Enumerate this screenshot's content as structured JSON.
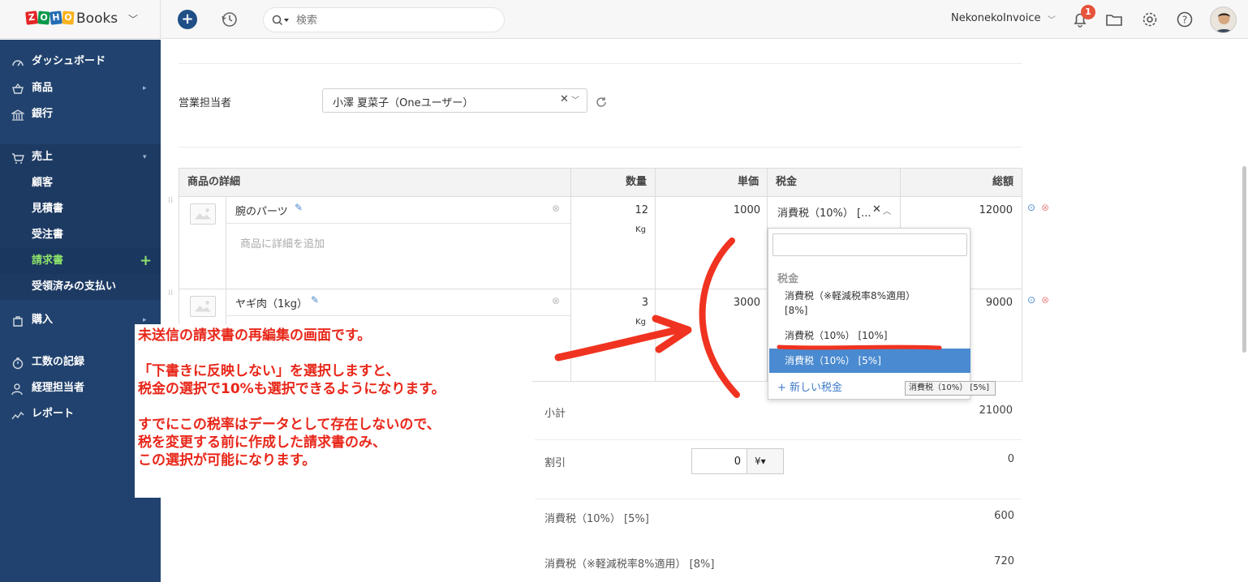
{
  "brand": {
    "logo_letters": [
      "Z",
      "O",
      "H",
      "O"
    ],
    "logo_colors": [
      "#e42527",
      "#089949",
      "#226db4",
      "#f9b21d"
    ],
    "name": "Books"
  },
  "topbar": {
    "search_placeholder": "検索",
    "org_name": "NekonekoInvoice",
    "notification_count": "1"
  },
  "sidebar": {
    "items": [
      {
        "label": "ダッシュボード",
        "icon": "dashboard-icon"
      },
      {
        "label": "商品",
        "icon": "cart-icon"
      },
      {
        "label": "銀行",
        "icon": "bank-icon"
      },
      {
        "label": "売上",
        "icon": "cart-icon"
      },
      {
        "label": "顧客"
      },
      {
        "label": "見積書"
      },
      {
        "label": "受注書"
      },
      {
        "label": "請求書"
      },
      {
        "label": "受領済みの支払い"
      },
      {
        "label": "購入",
        "icon": "bag-icon"
      },
      {
        "label": "工数の記録",
        "icon": "timer-icon"
      },
      {
        "label": "経理担当者",
        "icon": "user-icon"
      },
      {
        "label": "レポート",
        "icon": "reports-icon"
      }
    ],
    "active_item": "請求書"
  },
  "salesperson": {
    "label": "営業担当者",
    "value": "小澤 夏菜子（Oneユーザー）"
  },
  "table": {
    "headers": {
      "item": "商品の詳細",
      "qty": "数量",
      "rate": "単価",
      "tax": "税金",
      "amount": "総額"
    },
    "rows": [
      {
        "name": "腕のパーツ",
        "description_placeholder": "商品に詳細を追加",
        "qty": "12",
        "unit": "Kg",
        "rate": "1000",
        "tax": "消費税（10%） [...",
        "amount": "12000"
      },
      {
        "name": "ヤギ肉（1kg）",
        "qty": "3",
        "unit": "Kg",
        "rate": "3000",
        "amount": "9000"
      }
    ]
  },
  "tax_dropdown": {
    "group_label": "税金",
    "options": [
      {
        "line1": "消費税（※軽減税率8%適用）",
        "line2": "[8%]"
      },
      {
        "line1": "消費税（10%） [10%]"
      },
      {
        "line1": "消費税（10%） [5%]",
        "selected": true
      }
    ],
    "new_tax_label": "+ 新しい税金",
    "tooltip": "消費税（10%） [5%]"
  },
  "totals": {
    "subtotal_label": "小計",
    "subtotal": "21000",
    "discount_label": "割引",
    "discount_input": "0",
    "discount_unit": "¥▾",
    "discount": "0",
    "tax_lines": [
      {
        "label": "消費税（10%） [5%]",
        "value": "600"
      },
      {
        "label": "消費税（※軽減税率8%適用） [8%]",
        "value": "720"
      }
    ]
  },
  "annotation": {
    "lines": [
      "未送信の請求書の再編集の画面です。",
      "",
      "「下書きに反映しない」を選択しますと、",
      "税金の選択で10%も選択できるようになります。",
      "",
      "すでにこの税率はデータとして存在しないので、",
      "税を変更する前に作成した請求書のみ、",
      "この選択が可能になります。"
    ],
    "color": "#e8271a"
  }
}
